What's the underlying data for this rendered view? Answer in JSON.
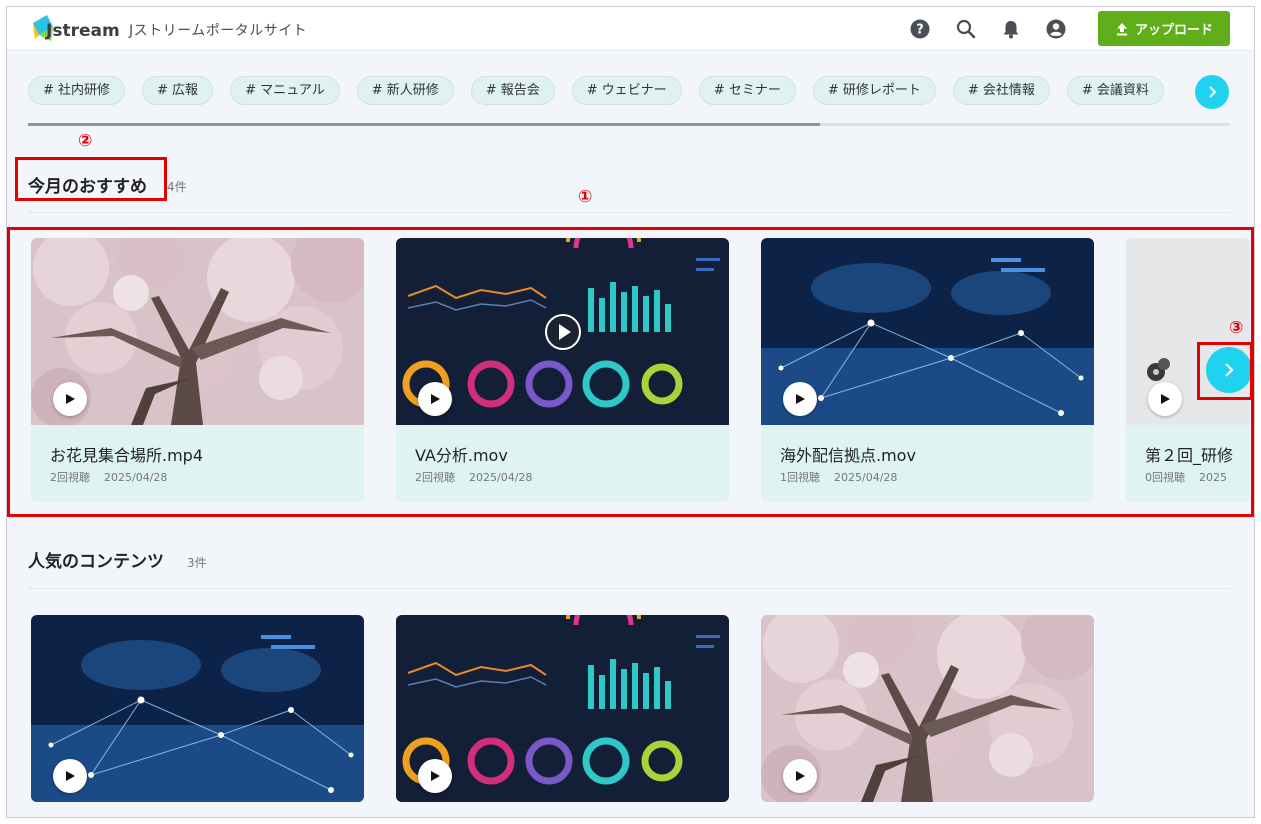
{
  "header": {
    "logo_text": "Jstream",
    "portal_title": "Jストリームポータルサイト",
    "upload_label": "アップロード",
    "icons": [
      "help-icon",
      "search-icon",
      "bell-icon",
      "account-icon"
    ]
  },
  "tags": [
    "# 社内研修",
    "# 広報",
    "# マニュアル",
    "# 新人研修",
    "# 報告会",
    "# ウェビナー",
    "# セミナー",
    "# 研修レポート",
    "# 会社情報",
    "# 会議資料"
  ],
  "recommend": {
    "title": "今月のおすすめ",
    "count": "4件",
    "cards": [
      {
        "name": "お花見集合場所.mp4",
        "views": "2回視聴",
        "date": "2025/04/28",
        "thumb": "cherry"
      },
      {
        "name": "VA分析.mov",
        "views": "2回視聴",
        "date": "2025/04/28",
        "thumb": "dashboard"
      },
      {
        "name": "海外配信拠点.mov",
        "views": "1回視聴",
        "date": "2025/04/28",
        "thumb": "network"
      },
      {
        "name": "第２回_研修",
        "views": "0回視聴",
        "date": "2025",
        "thumb": "gray"
      }
    ]
  },
  "popular": {
    "title": "人気のコンテンツ",
    "count": "3件",
    "cards": [
      {
        "thumb": "network"
      },
      {
        "thumb": "dashboard"
      },
      {
        "thumb": "cherry"
      }
    ]
  },
  "annotations": [
    "①",
    "②",
    "③"
  ],
  "colors": {
    "accent_cyan": "#1fd3f0",
    "upload_green": "#5fae1a",
    "annotation_red": "#e30000",
    "card_bg": "#dff3f3"
  }
}
